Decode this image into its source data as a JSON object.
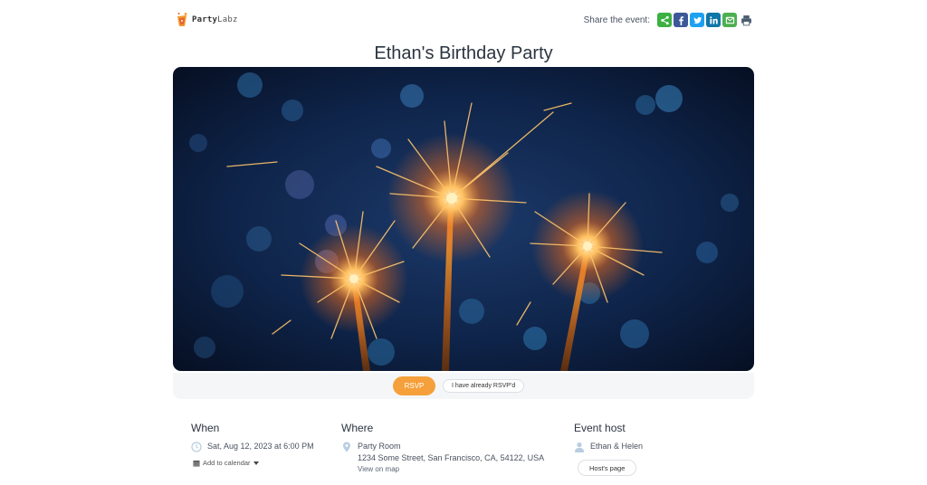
{
  "brand": {
    "name_bold": "Party",
    "name_light": "Labz"
  },
  "share": {
    "label": "Share the event:",
    "buttons": [
      {
        "icon": "share-icon",
        "color": "#3cb043"
      },
      {
        "icon": "facebook-icon",
        "color": "#3b5998"
      },
      {
        "icon": "twitter-icon",
        "color": "#1da1f2"
      },
      {
        "icon": "linkedin-icon",
        "color": "#0e76a8"
      },
      {
        "icon": "email-icon",
        "color": "#4caf50"
      },
      {
        "icon": "print-icon",
        "color": "#4d5d70"
      }
    ]
  },
  "event": {
    "title": "Ethan's Birthday Party"
  },
  "rsvp": {
    "rsvp_label": "RSVP",
    "already_label": "I have already RSVP'd",
    "accent": "#f5a03a"
  },
  "when": {
    "heading": "When",
    "datetime": "Sat, Aug 12, 2023 at 6:00 PM",
    "add_calendar": "Add to calendar"
  },
  "where": {
    "heading": "Where",
    "venue": "Party Room",
    "address": "1234 Some Street, San Francisco, CA, 54122, USA",
    "map_link": "View on map"
  },
  "host": {
    "heading": "Event host",
    "names": "Ethan & Helen",
    "page_button": "Host's page"
  }
}
